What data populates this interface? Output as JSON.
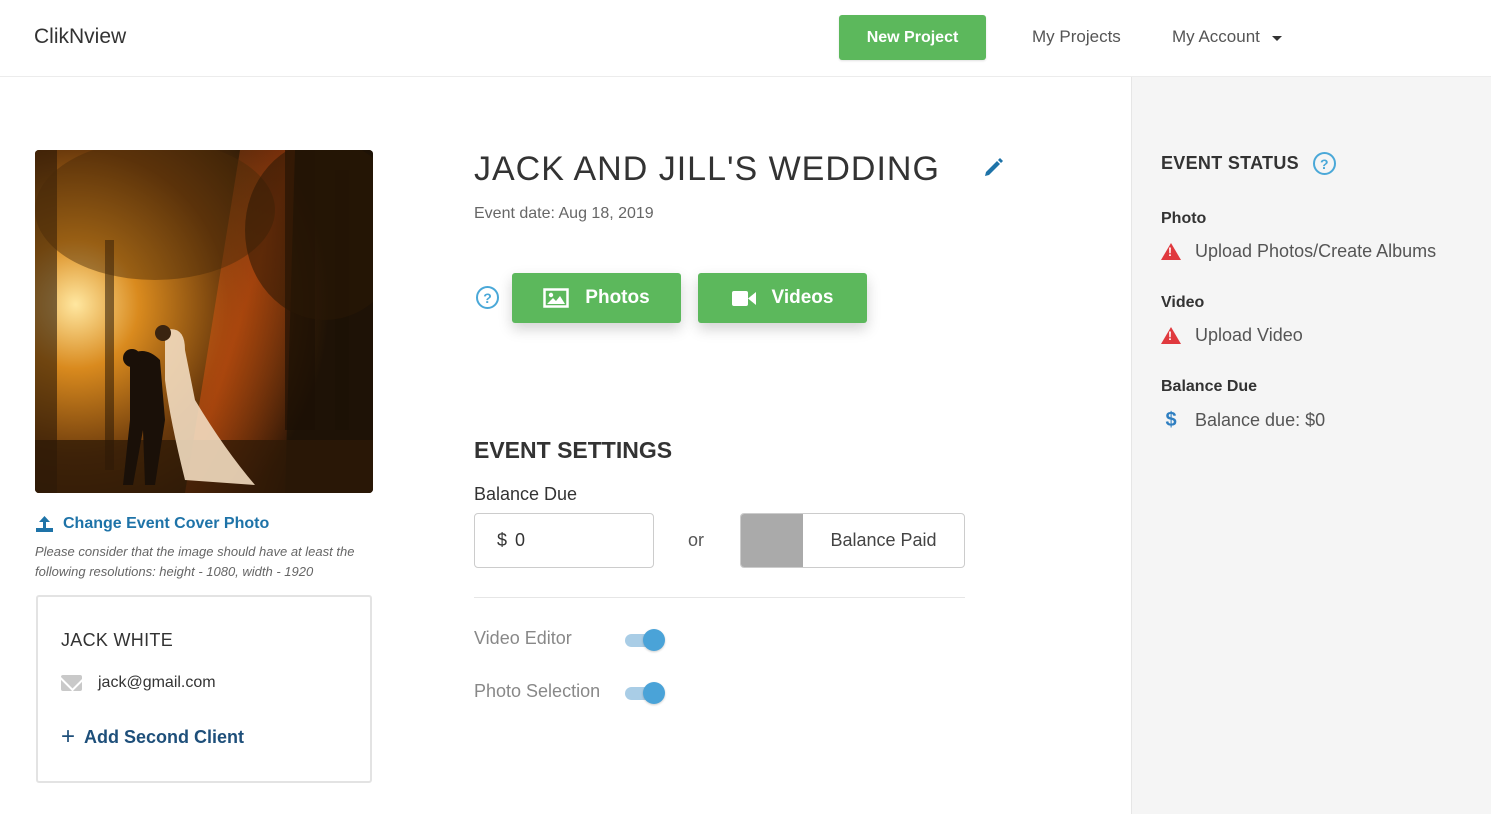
{
  "header": {
    "brand": "ClikNview",
    "new_project": "New Project",
    "nav_projects": "My Projects",
    "nav_account": "My Account"
  },
  "event": {
    "title": "JACK AND JILL'S WEDDING",
    "date": "Event date: Aug 18, 2019",
    "photos_label": "Photos",
    "videos_label": "Videos"
  },
  "cover": {
    "change_label": "Change Event Cover Photo",
    "note": "Please consider that the image should have at least the following resolutions: height - 1080, width - 1920"
  },
  "client": {
    "name": "JACK WHITE",
    "email": "jack@gmail.com",
    "add_second": "Add Second Client"
  },
  "settings": {
    "title": "EVENT SETTINGS",
    "balance_label": "Balance Due",
    "currency": "$",
    "balance_value": "0",
    "or": "or",
    "balance_paid": "Balance Paid",
    "video_editor": "Video Editor",
    "video_editor_on": true,
    "photo_selection": "Photo Selection",
    "photo_selection_on": true
  },
  "status": {
    "title": "EVENT STATUS",
    "photo_label": "Photo",
    "photo_status": "Upload Photos/Create Albums",
    "video_label": "Video",
    "video_status": "Upload Video",
    "balance_label": "Balance Due",
    "balance_status": "Balance due: $0"
  },
  "colors": {
    "green": "#5cb85c",
    "link_blue": "#1e73a8",
    "warning_red": "#e0393e",
    "toggle_blue": "#4aa3d8"
  }
}
